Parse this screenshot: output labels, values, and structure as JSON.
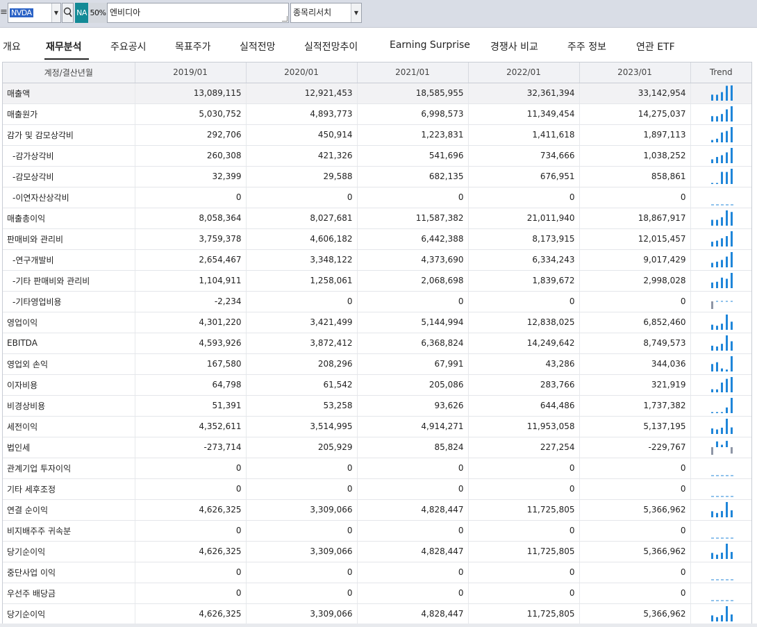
{
  "toolbar": {
    "menu_glyph": "≡",
    "code": "NVDA",
    "exchange_badge": "NA",
    "percent_badge": "50%",
    "company_name": "엔비디아",
    "search_select": "종목리서치"
  },
  "tabs": [
    {
      "label": "개요",
      "active": false
    },
    {
      "label": "재무분석",
      "active": true
    },
    {
      "label": "주요공시",
      "active": false
    },
    {
      "label": "목표주가",
      "active": false
    },
    {
      "label": "실적전망",
      "active": false
    },
    {
      "label": "실적전망추이",
      "active": false
    },
    {
      "label": "Earning Surprise",
      "active": false
    },
    {
      "label": "경쟁사 비교",
      "active": false
    },
    {
      "label": "주주 정보",
      "active": false
    },
    {
      "label": "연관 ETF",
      "active": false
    }
  ],
  "table": {
    "headers": [
      "계정/결산년월",
      "2019/01",
      "2020/01",
      "2021/01",
      "2022/01",
      "2023/01",
      "Trend"
    ],
    "rows": [
      {
        "label": "매출액",
        "sub": false,
        "values": [
          "13,089,115",
          "12,921,453",
          "18,585,955",
          "32,361,394",
          "33,142,954"
        ],
        "raw": [
          13089115,
          12921453,
          18585955,
          32361394,
          33142954
        ]
      },
      {
        "label": "매출원가",
        "sub": false,
        "values": [
          "5,030,752",
          "4,893,773",
          "6,998,573",
          "11,349,454",
          "14,275,037"
        ],
        "raw": [
          5030752,
          4893773,
          6998573,
          11349454,
          14275037
        ]
      },
      {
        "label": "감가 및 감모상각비",
        "sub": false,
        "values": [
          "292,706",
          "450,914",
          "1,223,831",
          "1,411,618",
          "1,897,113"
        ],
        "raw": [
          292706,
          450914,
          1223831,
          1411618,
          1897113
        ]
      },
      {
        "label": "-감가상각비",
        "sub": true,
        "values": [
          "260,308",
          "421,326",
          "541,696",
          "734,666",
          "1,038,252"
        ],
        "raw": [
          260308,
          421326,
          541696,
          734666,
          1038252
        ]
      },
      {
        "label": "-감모상각비",
        "sub": true,
        "values": [
          "32,399",
          "29,588",
          "682,135",
          "676,951",
          "858,861"
        ],
        "raw": [
          32399,
          29588,
          682135,
          676951,
          858861
        ]
      },
      {
        "label": "-이연자산상각비",
        "sub": true,
        "values": [
          "0",
          "0",
          "0",
          "0",
          "0"
        ],
        "raw": [
          0,
          0,
          0,
          0,
          0
        ]
      },
      {
        "label": "매출총이익",
        "sub": false,
        "values": [
          "8,058,364",
          "8,027,681",
          "11,587,382",
          "21,011,940",
          "18,867,917"
        ],
        "raw": [
          8058364,
          8027681,
          11587382,
          21011940,
          18867917
        ]
      },
      {
        "label": "판매비와 관리비",
        "sub": false,
        "values": [
          "3,759,378",
          "4,606,182",
          "6,442,388",
          "8,173,915",
          "12,015,457"
        ],
        "raw": [
          3759378,
          4606182,
          6442388,
          8173915,
          12015457
        ]
      },
      {
        "label": "-연구개발비",
        "sub": true,
        "values": [
          "2,654,467",
          "3,348,122",
          "4,373,690",
          "6,334,243",
          "9,017,429"
        ],
        "raw": [
          2654467,
          3348122,
          4373690,
          6334243,
          9017429
        ]
      },
      {
        "label": "-기타 판매비와 관리비",
        "sub": true,
        "values": [
          "1,104,911",
          "1,258,061",
          "2,068,698",
          "1,839,672",
          "2,998,028"
        ],
        "raw": [
          1104911,
          1258061,
          2068698,
          1839672,
          2998028
        ]
      },
      {
        "label": "-기타영업비용",
        "sub": true,
        "values": [
          "-2,234",
          "0",
          "0",
          "0",
          "0"
        ],
        "raw": [
          -2234,
          0,
          0,
          0,
          0
        ]
      },
      {
        "label": "영업이익",
        "sub": false,
        "values": [
          "4,301,220",
          "3,421,499",
          "5,144,994",
          "12,838,025",
          "6,852,460"
        ],
        "raw": [
          4301220,
          3421499,
          5144994,
          12838025,
          6852460
        ]
      },
      {
        "label": "EBITDA",
        "sub": false,
        "values": [
          "4,593,926",
          "3,872,412",
          "6,368,824",
          "14,249,642",
          "8,749,573"
        ],
        "raw": [
          4593926,
          3872412,
          6368824,
          14249642,
          8749573
        ]
      },
      {
        "label": "영업외 손익",
        "sub": false,
        "values": [
          "167,580",
          "208,296",
          "67,991",
          "43,286",
          "344,036"
        ],
        "raw": [
          167580,
          208296,
          67991,
          43286,
          344036
        ]
      },
      {
        "label": "이자비용",
        "sub": false,
        "values": [
          "64,798",
          "61,542",
          "205,086",
          "283,766",
          "321,919"
        ],
        "raw": [
          64798,
          61542,
          205086,
          283766,
          321919
        ]
      },
      {
        "label": "비경상비용",
        "sub": false,
        "values": [
          "51,391",
          "53,258",
          "93,626",
          "644,486",
          "1,737,382"
        ],
        "raw": [
          51391,
          53258,
          93626,
          644486,
          1737382
        ]
      },
      {
        "label": "세전이익",
        "sub": false,
        "values": [
          "4,352,611",
          "3,514,995",
          "4,914,271",
          "11,953,058",
          "5,137,195"
        ],
        "raw": [
          4352611,
          3514995,
          4914271,
          11953058,
          5137195
        ]
      },
      {
        "label": "법인세",
        "sub": false,
        "values": [
          "-273,714",
          "205,929",
          "85,824",
          "227,254",
          "-229,767"
        ],
        "raw": [
          -273714,
          205929,
          85824,
          227254,
          -229767
        ]
      },
      {
        "label": "관계기업 투자이익",
        "sub": false,
        "values": [
          "0",
          "0",
          "0",
          "0",
          "0"
        ],
        "raw": [
          0,
          0,
          0,
          0,
          0
        ]
      },
      {
        "label": "기타 세후조정",
        "sub": false,
        "values": [
          "0",
          "0",
          "0",
          "0",
          "0"
        ],
        "raw": [
          0,
          0,
          0,
          0,
          0
        ]
      },
      {
        "label": "연결 순이익",
        "sub": false,
        "values": [
          "4,626,325",
          "3,309,066",
          "4,828,447",
          "11,725,805",
          "5,366,962"
        ],
        "raw": [
          4626325,
          3309066,
          4828447,
          11725805,
          5366962
        ]
      },
      {
        "label": "비지배주주 귀속분",
        "sub": false,
        "values": [
          "0",
          "0",
          "0",
          "0",
          "0"
        ],
        "raw": [
          0,
          0,
          0,
          0,
          0
        ]
      },
      {
        "label": "당기순이익",
        "sub": false,
        "values": [
          "4,626,325",
          "3,309,066",
          "4,828,447",
          "11,725,805",
          "5,366,962"
        ],
        "raw": [
          4626325,
          3309066,
          4828447,
          11725805,
          5366962
        ]
      },
      {
        "label": "중단사업 이익",
        "sub": false,
        "values": [
          "0",
          "0",
          "0",
          "0",
          "0"
        ],
        "raw": [
          0,
          0,
          0,
          0,
          0
        ]
      },
      {
        "label": "우선주 배당금",
        "sub": false,
        "values": [
          "0",
          "0",
          "0",
          "0",
          "0"
        ],
        "raw": [
          0,
          0,
          0,
          0,
          0
        ]
      },
      {
        "label": "당기순이익",
        "sub": false,
        "values": [
          "4,626,325",
          "3,309,066",
          "4,828,447",
          "11,725,805",
          "5,366,962"
        ],
        "raw": [
          4626325,
          3309066,
          4828447,
          11725805,
          5366962
        ]
      }
    ]
  },
  "colors": {
    "positive_bar": "#1f86d9",
    "negative_bar": "#8e96a6",
    "zero_line": "#1f86d9",
    "na_badge": "#138a96"
  }
}
